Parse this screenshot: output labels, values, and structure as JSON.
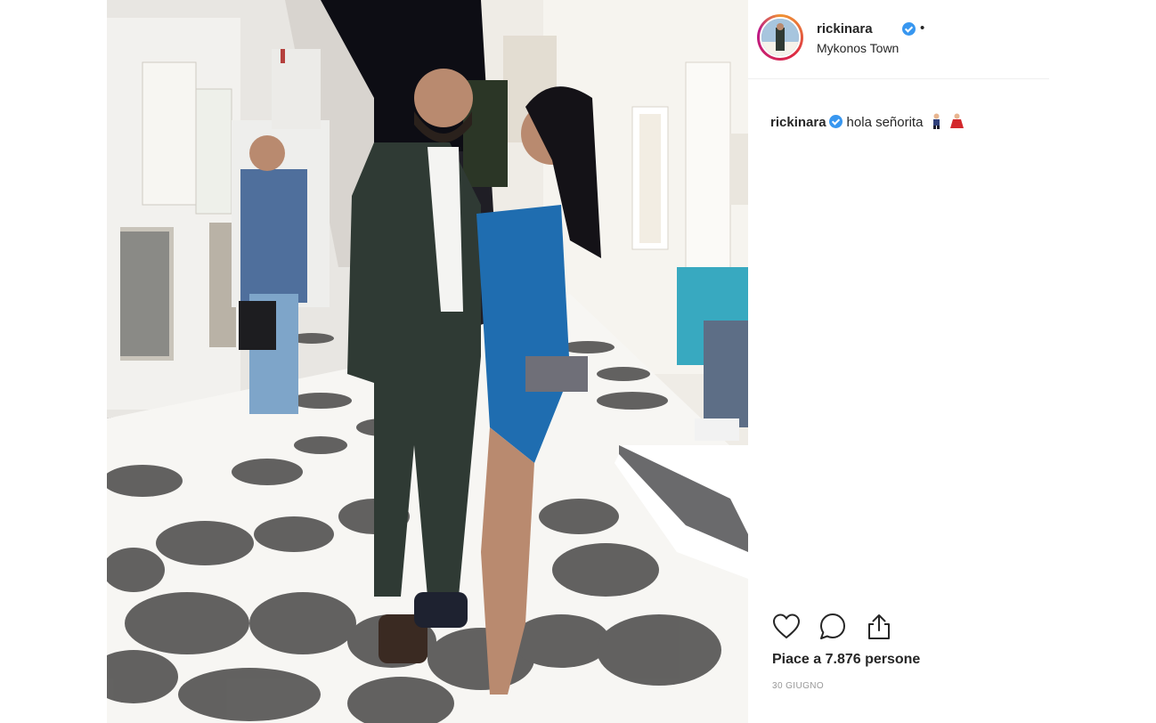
{
  "post": {
    "username": "rickinara",
    "location": "Mykonos Town",
    "separator": "•",
    "caption": {
      "username": "rickinara",
      "text": "hola señorita"
    },
    "likes_text": "Piace a 7.876 persone",
    "date_text": "30 GIUGNO"
  },
  "icons": {
    "verified": "verified-badge-icon",
    "like": "heart-icon",
    "comment": "comment-icon",
    "share": "share-icon"
  },
  "colors": {
    "verified_blue": "#3897f0",
    "text": "#262626",
    "muted": "#999999",
    "divider": "#efefef"
  }
}
